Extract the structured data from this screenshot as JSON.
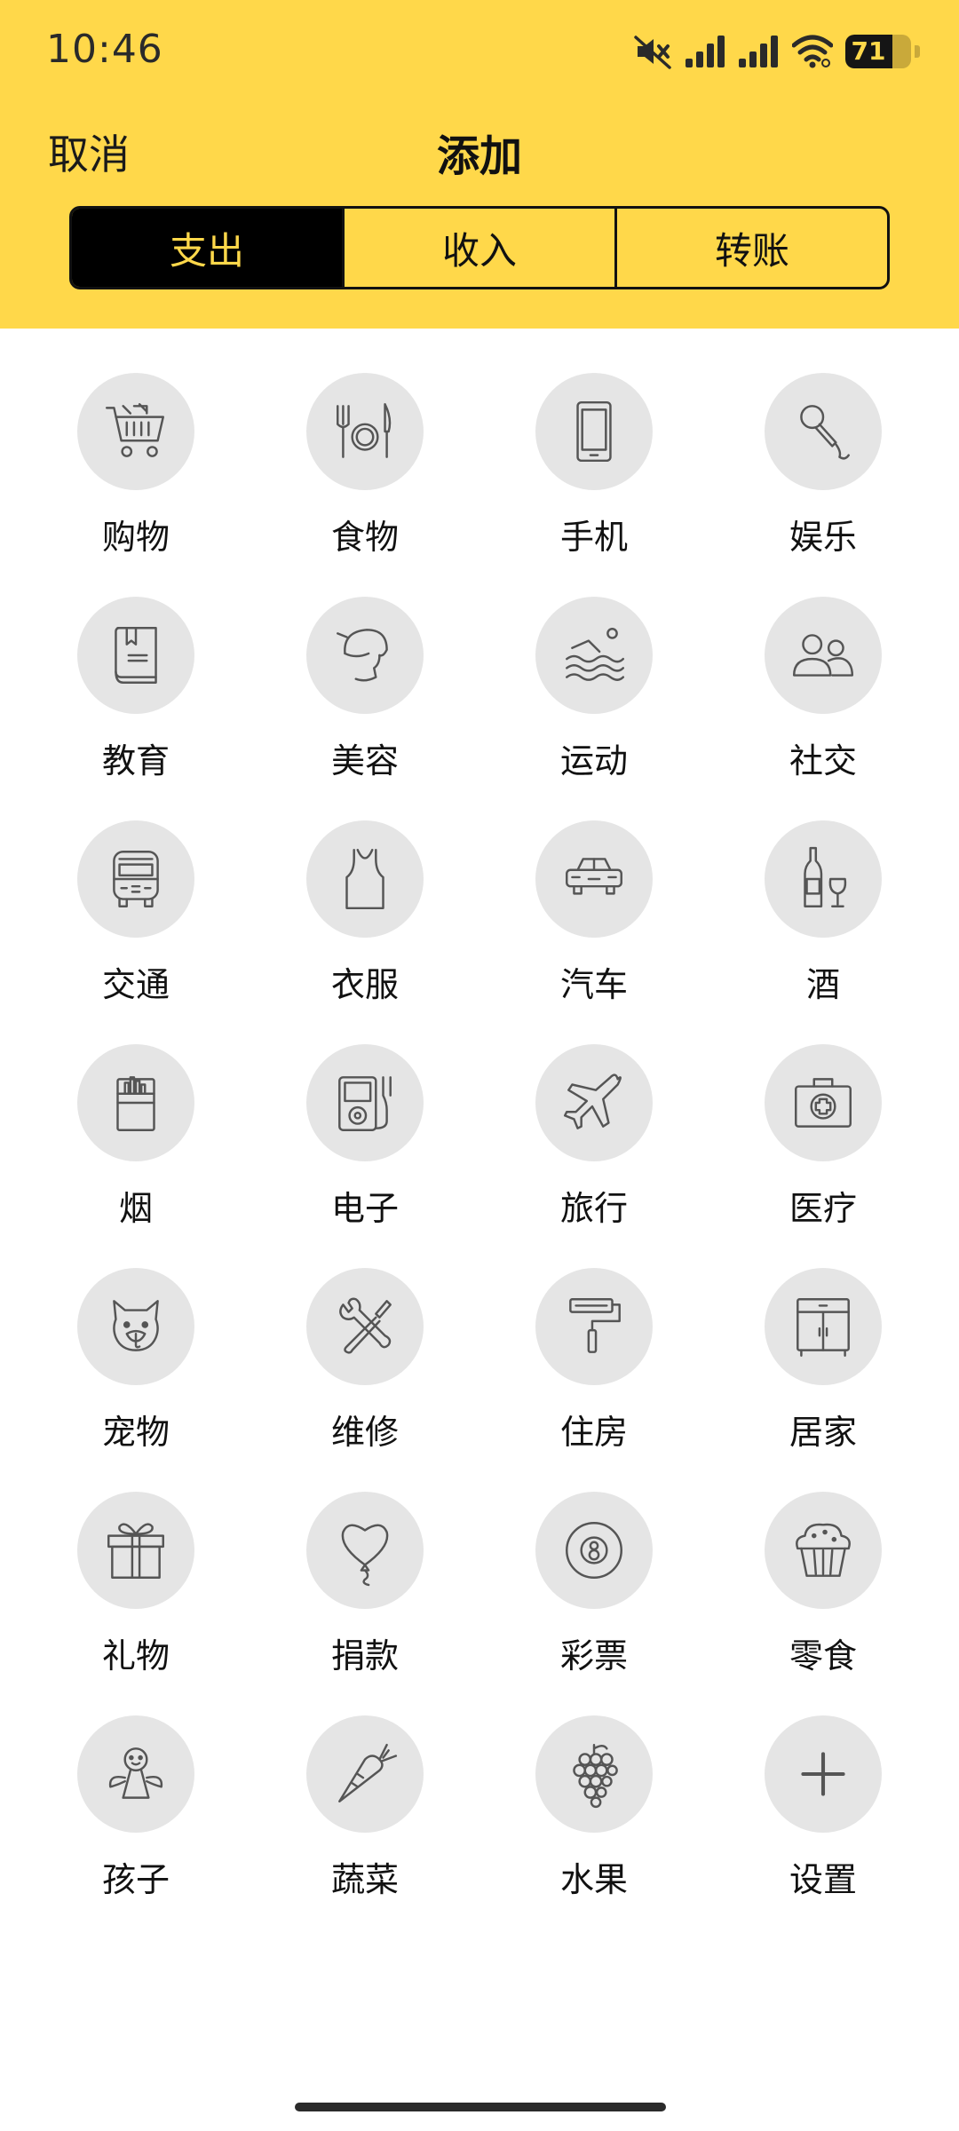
{
  "status_bar": {
    "time": "10:46",
    "battery_level": "71",
    "icons": [
      "mute-icon",
      "signal-icon",
      "signal-icon",
      "wifi-icon",
      "battery-icon"
    ]
  },
  "nav": {
    "cancel_label": "取消",
    "title": "添加"
  },
  "segments": [
    {
      "label": "支出",
      "active": true
    },
    {
      "label": "收入",
      "active": false
    },
    {
      "label": "转账",
      "active": false
    }
  ],
  "categories": [
    {
      "label": "购物",
      "icon": "shopping-cart-icon"
    },
    {
      "label": "食物",
      "icon": "fork-plate-knife-icon"
    },
    {
      "label": "手机",
      "icon": "phone-icon"
    },
    {
      "label": "娱乐",
      "icon": "microphone-icon"
    },
    {
      "label": "教育",
      "icon": "book-icon"
    },
    {
      "label": "美容",
      "icon": "beauty-head-icon"
    },
    {
      "label": "运动",
      "icon": "swimming-icon"
    },
    {
      "label": "社交",
      "icon": "people-icon"
    },
    {
      "label": "交通",
      "icon": "bus-icon"
    },
    {
      "label": "衣服",
      "icon": "tank-top-icon"
    },
    {
      "label": "汽车",
      "icon": "car-icon"
    },
    {
      "label": "酒",
      "icon": "wine-icon"
    },
    {
      "label": "烟",
      "icon": "cigarette-pack-icon"
    },
    {
      "label": "电子",
      "icon": "music-player-icon"
    },
    {
      "label": "旅行",
      "icon": "airplane-icon"
    },
    {
      "label": "医疗",
      "icon": "first-aid-kit-icon"
    },
    {
      "label": "宠物",
      "icon": "pet-icon"
    },
    {
      "label": "维修",
      "icon": "tools-icon"
    },
    {
      "label": "住房",
      "icon": "paint-roller-icon"
    },
    {
      "label": "居家",
      "icon": "cabinet-icon"
    },
    {
      "label": "礼物",
      "icon": "gift-icon"
    },
    {
      "label": "捐款",
      "icon": "heart-balloon-icon"
    },
    {
      "label": "彩票",
      "icon": "eight-ball-icon"
    },
    {
      "label": "零食",
      "icon": "muffin-icon"
    },
    {
      "label": "孩子",
      "icon": "angel-child-icon"
    },
    {
      "label": "蔬菜",
      "icon": "carrot-icon"
    },
    {
      "label": "水果",
      "icon": "grapes-icon"
    },
    {
      "label": "设置",
      "icon": "plus-icon"
    }
  ]
}
